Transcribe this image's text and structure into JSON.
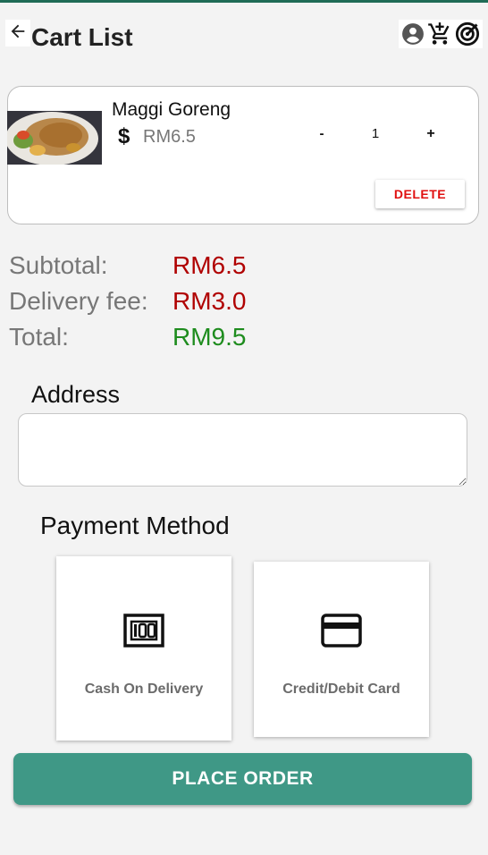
{
  "app": {
    "accent_color": "#3f9886",
    "top_line_color": "#1f6b56"
  },
  "header": {
    "title": "Cart List",
    "back_icon": "arrow-left-icon",
    "icons": [
      "account-circle-icon",
      "add-to-cart-icon",
      "radar-icon"
    ]
  },
  "cart": {
    "items": [
      {
        "name": "Maggi Goreng",
        "currency_icon": "dollar-icon",
        "price": "RM6.5",
        "quantity": "1",
        "minus_label": "-",
        "plus_label": "+",
        "delete_label": "DELETE"
      }
    ]
  },
  "summary": {
    "subtotal_label": "Subtotal:",
    "subtotal_value": "RM6.5",
    "delivery_label": "Delivery fee:",
    "delivery_value": "RM3.0",
    "total_label": "Total:",
    "total_value": "RM9.5",
    "value_color": "#b00000",
    "total_color": "#1e8c1e"
  },
  "address": {
    "label": "Address",
    "value": "",
    "placeholder": ""
  },
  "payment": {
    "label": "Payment Method",
    "methods": [
      {
        "label": "Cash On Delivery",
        "icon": "cash-icon"
      },
      {
        "label": "Credit/Debit Card",
        "icon": "credit-card-icon"
      }
    ]
  },
  "actions": {
    "place_order_label": "PLACE ORDER"
  }
}
